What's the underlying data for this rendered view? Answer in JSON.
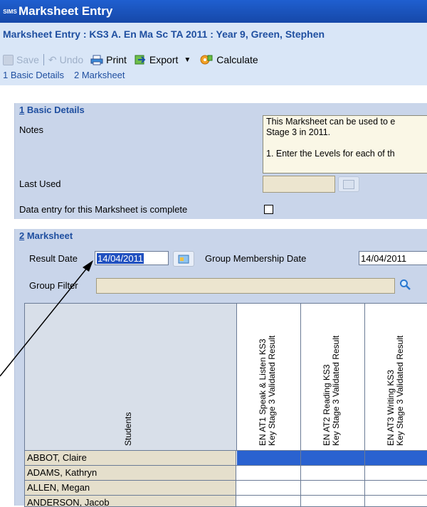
{
  "window": {
    "logo_text": "SIMS",
    "title": "Marksheet Entry"
  },
  "header": {
    "subtitle": "Marksheet Entry : KS3 A. En Ma Sc TA 2011 : Year 9, Green, Stephen",
    "toolbar": {
      "save_label": "Save",
      "undo_label": "Undo",
      "print_label": "Print",
      "export_label": "Export",
      "calculate_label": "Calculate"
    },
    "nav_links": [
      "1 Basic Details",
      "2 Marksheet"
    ]
  },
  "basic_details": {
    "title_number": "1",
    "title_text": " Basic Details",
    "notes_label": "Notes",
    "notes_lines": [
      "This Marksheet can be used to e",
      "Stage 3 in 2011.",
      "",
      "1. Enter the Levels for each of th"
    ],
    "last_used_label": "Last Used",
    "complete_label": "Data entry for this Marksheet is complete"
  },
  "marksheet": {
    "title_number": "2",
    "title_text": " Marksheet",
    "result_date_label": "Result Date",
    "result_date_value": "14/04/2011",
    "group_membership_label": "Group Membership Date",
    "group_membership_value": "14/04/2011",
    "group_filter_label": "Group Filter",
    "students_header": "Students",
    "columns": [
      {
        "line1": "EN AT1 Speak & Listen KS3",
        "line2": "Key Stage 3 Validated Result"
      },
      {
        "line1": "EN AT2 Reading KS3",
        "line2": "Key Stage 3 Validated Result"
      },
      {
        "line1": "EN AT3 Writing KS3",
        "line2": "Key Stage 3 Validated Result"
      }
    ],
    "students": [
      "ABBOT, Claire",
      "ADAMS, Kathryn",
      "ALLEN, Megan",
      "ANDERSON, Jacob"
    ]
  }
}
